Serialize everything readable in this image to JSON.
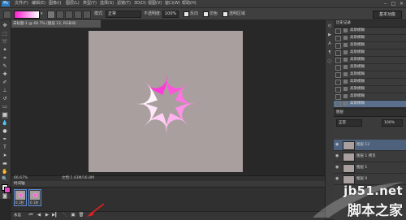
{
  "menubar": {
    "logo": "Ps",
    "items": [
      "文件(F)",
      "编辑(E)",
      "图像(I)",
      "图层(L)",
      "类型(Y)",
      "选择(S)",
      "滤镜(T)",
      "3D(D)",
      "视图(V)",
      "窗口(W)",
      "帮助(H)"
    ],
    "win_min": "–",
    "win_max": "□",
    "win_close": "×"
  },
  "options": {
    "mode_label": "模式:",
    "mode_value": "正常",
    "opacity_label": "不透明度:",
    "opacity_value": "100%",
    "reverse_label": "反向",
    "dither_label": "仿色",
    "transparency_label": "透明区域",
    "workspace": "基本功能",
    "gradient_colors": [
      "#ff1dd0",
      "#ffffff"
    ]
  },
  "document": {
    "tab_title": "未标题-1 @ 66.7% (图层 12, RGB/8)"
  },
  "status": {
    "zoom": "66.67%",
    "doc_info": "文档:1.43M/16.8M"
  },
  "timeline": {
    "tab_label": "时间轴",
    "frames": [
      {
        "delay": "0.1秒"
      },
      {
        "delay": "0.1秒"
      }
    ],
    "loop": "永远"
  },
  "history": {
    "title": "历史记录",
    "items": [
      "高斯模糊",
      "高斯模糊",
      "高斯模糊",
      "高斯模糊",
      "高斯模糊",
      "高斯模糊",
      "高斯模糊",
      "高斯模糊",
      "高斯模糊",
      "高斯模糊",
      "高斯模糊"
    ]
  },
  "layers": {
    "title": "图层",
    "mode": "正常",
    "opacity": "100%",
    "items": [
      "图层 12",
      "图层 1 拷贝",
      "图层 1",
      "图层 0"
    ]
  },
  "canvas": {
    "background": "#a99f9e",
    "petal_colors": [
      "#ff3ad8",
      "#ff55dd",
      "#ff73e2",
      "#ff90e8",
      "#ffb1ee",
      "#ffd0f4",
      "#ffe6f9",
      "#fff6fd"
    ]
  },
  "watermark": {
    "domain": "jb51.net",
    "name": "脚本之家"
  }
}
